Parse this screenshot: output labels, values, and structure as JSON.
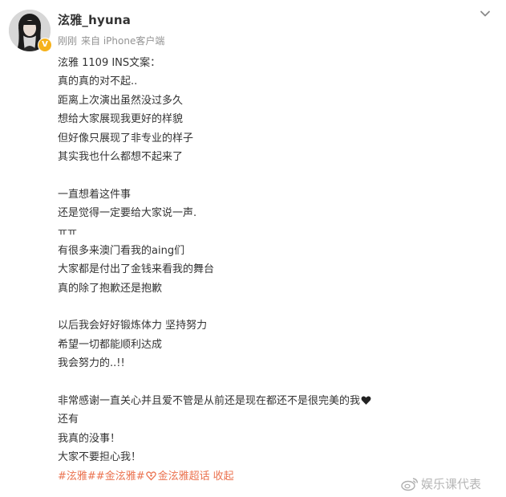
{
  "post": {
    "author": {
      "name": "泫雅_hyuna",
      "verified_badge": "V",
      "time": "刚刚",
      "source": "来自 iPhone客户端"
    },
    "menu_icon": "chevron-down-icon",
    "lines": [
      "泫雅 1109 INS文案：",
      "真的真的对不起..",
      "距离上次演出虽然没过多久",
      "想给大家展现我更好的样貌",
      "但好像只展现了非专业的样子",
      "其实我也什么都想不起来了",
      "",
      "一直想着这件事",
      "还是觉得一定要给大家说一声.",
      "ㅠㅠ",
      "有很多来澳门看我的aing们",
      "大家都是付出了金钱来看我的舞台",
      "真的除了抱歉还是抱歉",
      "",
      "以后我会好好锻炼体力 坚持努力",
      "希望一切都能顺利达成",
      "我会努力的..!!",
      "",
      "非常感谢一直关心并且爱不管是从前还是现在都还不是很完美的我",
      "还有",
      "我真的没事！",
      "大家不要担心我！"
    ],
    "heart_line_index": 18,
    "tags": {
      "tag1": "#泫雅#",
      "tag2": "#金泫雅#",
      "super_topic": "金泫雅超话",
      "collapse": "收起"
    },
    "colors": {
      "link": "#eb7350",
      "text": "#333333",
      "meta": "#939393",
      "badge": "#f6b21b"
    }
  },
  "watermark": {
    "text": "娱乐课代表",
    "icon": "weibo-logo-icon"
  }
}
